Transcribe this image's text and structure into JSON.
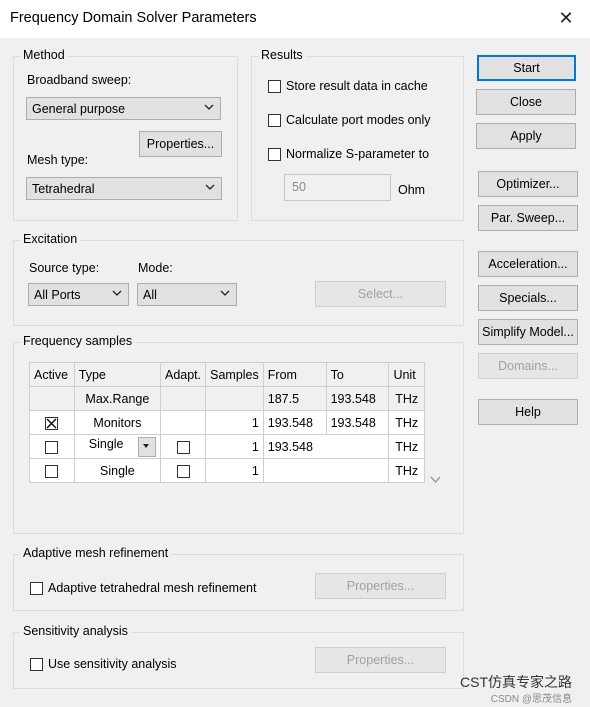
{
  "window": {
    "title": "Frequency Domain Solver Parameters"
  },
  "method": {
    "label": "Method",
    "broadband_label": "Broadband sweep:",
    "broadband_value": "General purpose",
    "properties_btn": "Properties...",
    "mesh_label": "Mesh type:",
    "mesh_value": "Tetrahedral"
  },
  "results": {
    "label": "Results",
    "store": "Store result data in cache",
    "port_modes": "Calculate port modes only",
    "normalize": "Normalize S-parameter to",
    "impedance_value": "50",
    "impedance_unit": "Ohm"
  },
  "buttons": {
    "start": "Start",
    "close": "Close",
    "apply": "Apply",
    "optimizer": "Optimizer...",
    "par_sweep": "Par. Sweep...",
    "acceleration": "Acceleration...",
    "specials": "Specials...",
    "simplify": "Simplify Model...",
    "domains": "Domains...",
    "help": "Help"
  },
  "excitation": {
    "label": "Excitation",
    "source_label": "Source type:",
    "source_value": "All Ports",
    "mode_label": "Mode:",
    "mode_value": "All",
    "select_btn": "Select..."
  },
  "freq": {
    "label": "Frequency samples",
    "headers": [
      "Active",
      "Type",
      "Adapt.",
      "Samples",
      "From",
      "To",
      "Unit"
    ],
    "rows": [
      {
        "type": "Max.Range",
        "samples": "",
        "from": "187.5",
        "to": "193.548",
        "unit": "THz"
      },
      {
        "type": "Monitors",
        "samples": "1",
        "from": "193.548",
        "to": "193.548",
        "unit": "THz"
      },
      {
        "type": "Single",
        "samples": "1",
        "from": "193.548",
        "to": "",
        "unit": "THz"
      },
      {
        "type": "Single",
        "samples": "1",
        "from": "",
        "to": "",
        "unit": "THz"
      }
    ]
  },
  "adaptive": {
    "label": "Adaptive mesh refinement",
    "check": "Adaptive tetrahedral mesh refinement",
    "properties_btn": "Properties..."
  },
  "sensitivity": {
    "label": "Sensitivity analysis",
    "check": "Use sensitivity analysis",
    "properties_btn": "Properties..."
  },
  "watermark": {
    "line1": "CST仿真专家之路",
    "line2": "CSDN @思茂信息"
  }
}
